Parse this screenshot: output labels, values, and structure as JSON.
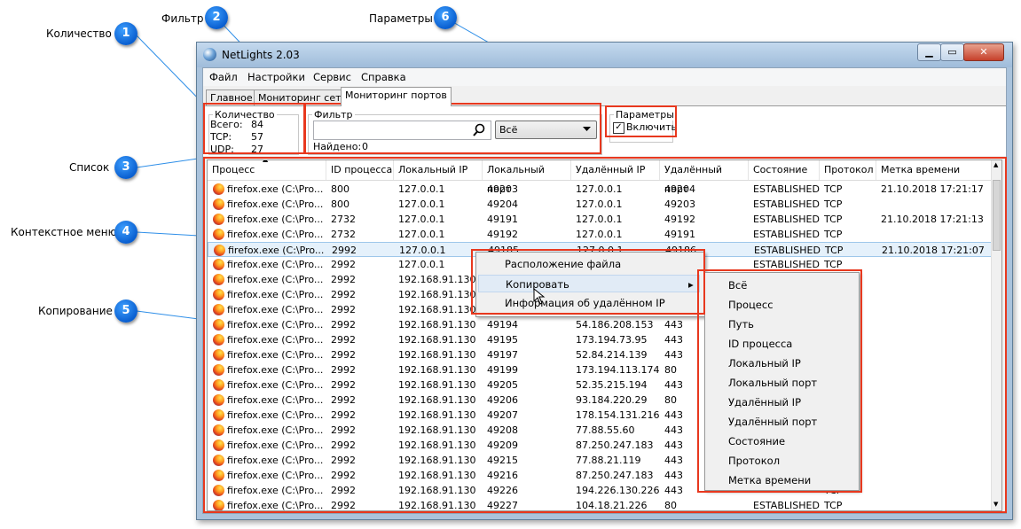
{
  "callouts": [
    {
      "num": "1",
      "label": "Количество"
    },
    {
      "num": "2",
      "label": "Фильтр"
    },
    {
      "num": "3",
      "label": "Список"
    },
    {
      "num": "4",
      "label": "Контекстное меню"
    },
    {
      "num": "5",
      "label": "Копирование"
    },
    {
      "num": "6",
      "label": "Параметры"
    }
  ],
  "window": {
    "title": "NetLights 2.03",
    "controls": {
      "minimize": "▁",
      "maximize": "▭",
      "close": "✕"
    }
  },
  "menu": [
    "Файл",
    "Настройки",
    "Сервис",
    "Справка"
  ],
  "tabs": [
    "Главное",
    "Мониторинг сети",
    "Мониторинг портов"
  ],
  "count": {
    "title": "Количество",
    "rows": [
      {
        "label": "Всего:",
        "value": "84"
      },
      {
        "label": "TCP:",
        "value": "57"
      },
      {
        "label": "UDP:",
        "value": "27"
      }
    ]
  },
  "filter": {
    "title": "Фильтр",
    "value": "",
    "combo": "Всё",
    "found_label": "Найдено:",
    "found_value": "0"
  },
  "params": {
    "title": "Параметры",
    "checkbox_label": "Включить",
    "checked": true
  },
  "table": {
    "columns": [
      "Процесс",
      "ID процесса",
      "Локальный IP",
      "Локальный порт",
      "Удалённый IP",
      "Удалённый порт",
      "Состояние",
      "Протокол",
      "Метка времени"
    ],
    "rows": [
      [
        "firefox.exe (C:\\Pro...",
        "800",
        "127.0.0.1",
        "49203",
        "127.0.0.1",
        "49204",
        "ESTABLISHED",
        "TCP",
        "21.10.2018 17:21:17"
      ],
      [
        "firefox.exe (C:\\Pro...",
        "800",
        "127.0.0.1",
        "49204",
        "127.0.0.1",
        "49203",
        "ESTABLISHED",
        "TCP",
        ""
      ],
      [
        "firefox.exe (C:\\Pro...",
        "2732",
        "127.0.0.1",
        "49191",
        "127.0.0.1",
        "49192",
        "ESTABLISHED",
        "TCP",
        "21.10.2018 17:21:13"
      ],
      [
        "firefox.exe (C:\\Pro...",
        "2732",
        "127.0.0.1",
        "49192",
        "127.0.0.1",
        "49191",
        "ESTABLISHED",
        "TCP",
        ""
      ],
      [
        "firefox.exe (C:\\Pro...",
        "2992",
        "127.0.0.1",
        "49185",
        "127.0.0.1",
        "49186",
        "ESTABLISHED",
        "TCP",
        "21.10.2018 17:21:07"
      ],
      [
        "firefox.exe (C:\\Pro...",
        "2992",
        "127.0.0.1",
        "",
        "",
        "",
        "ESTABLISHED",
        "TCP",
        ""
      ],
      [
        "firefox.exe (C:\\Pro...",
        "2992",
        "192.168.91.130",
        "",
        "",
        "",
        "",
        "",
        ""
      ],
      [
        "firefox.exe (C:\\Pro...",
        "2992",
        "192.168.91.130",
        "",
        "",
        "",
        "",
        "",
        ""
      ],
      [
        "firefox.exe (C:\\Pro...",
        "2992",
        "192.168.91.130",
        "",
        "",
        "",
        "",
        "",
        ""
      ],
      [
        "firefox.exe (C:\\Pro...",
        "2992",
        "192.168.91.130",
        "49194",
        "54.186.208.153",
        "443",
        "",
        "",
        ""
      ],
      [
        "firefox.exe (C:\\Pro...",
        "2992",
        "192.168.91.130",
        "49195",
        "173.194.73.95",
        "443",
        "",
        "",
        ""
      ],
      [
        "firefox.exe (C:\\Pro...",
        "2992",
        "192.168.91.130",
        "49197",
        "52.84.214.139",
        "443",
        "",
        "",
        ""
      ],
      [
        "firefox.exe (C:\\Pro...",
        "2992",
        "192.168.91.130",
        "49199",
        "173.194.113.174",
        "80",
        "",
        "",
        ""
      ],
      [
        "firefox.exe (C:\\Pro...",
        "2992",
        "192.168.91.130",
        "49205",
        "52.35.215.194",
        "443",
        "",
        "",
        ""
      ],
      [
        "firefox.exe (C:\\Pro...",
        "2992",
        "192.168.91.130",
        "49206",
        "93.184.220.29",
        "80",
        "",
        "",
        ""
      ],
      [
        "firefox.exe (C:\\Pro...",
        "2992",
        "192.168.91.130",
        "49207",
        "178.154.131.216",
        "443",
        "",
        "",
        ""
      ],
      [
        "firefox.exe (C:\\Pro...",
        "2992",
        "192.168.91.130",
        "49208",
        "77.88.55.60",
        "443",
        "",
        "",
        ""
      ],
      [
        "firefox.exe (C:\\Pro...",
        "2992",
        "192.168.91.130",
        "49209",
        "87.250.247.183",
        "443",
        "",
        "",
        ""
      ],
      [
        "firefox.exe (C:\\Pro...",
        "2992",
        "192.168.91.130",
        "49215",
        "77.88.21.119",
        "443",
        "",
        "",
        ""
      ],
      [
        "firefox.exe (C:\\Pro...",
        "2992",
        "192.168.91.130",
        "49216",
        "87.250.247.183",
        "443",
        "",
        "",
        ""
      ],
      [
        "firefox.exe (C:\\Pro...",
        "2992",
        "192.168.91.130",
        "49226",
        "194.226.130.226",
        "443",
        "",
        "TCP",
        ""
      ],
      [
        "firefox.exe (C:\\Pro...",
        "2992",
        "192.168.91.130",
        "49227",
        "104.18.21.226",
        "80",
        "ESTABLISHED",
        "TCP",
        ""
      ]
    ],
    "selected_row": 4
  },
  "context_menu": [
    "Расположение файла",
    "Копировать",
    "Информация об удалённом IP"
  ],
  "submenu_arrow": "▸",
  "copy_submenu": [
    "Всё",
    "Процесс",
    "Путь",
    "ID процесса",
    "Локальный IP",
    "Локальный порт",
    "Удалённый IP",
    "Удалённый порт",
    "Состояние",
    "Протокол",
    "Метка времени"
  ],
  "colors": {
    "highlight": "#e8381e",
    "badge": "#1a73e0",
    "selection": "#e5f1fb"
  }
}
